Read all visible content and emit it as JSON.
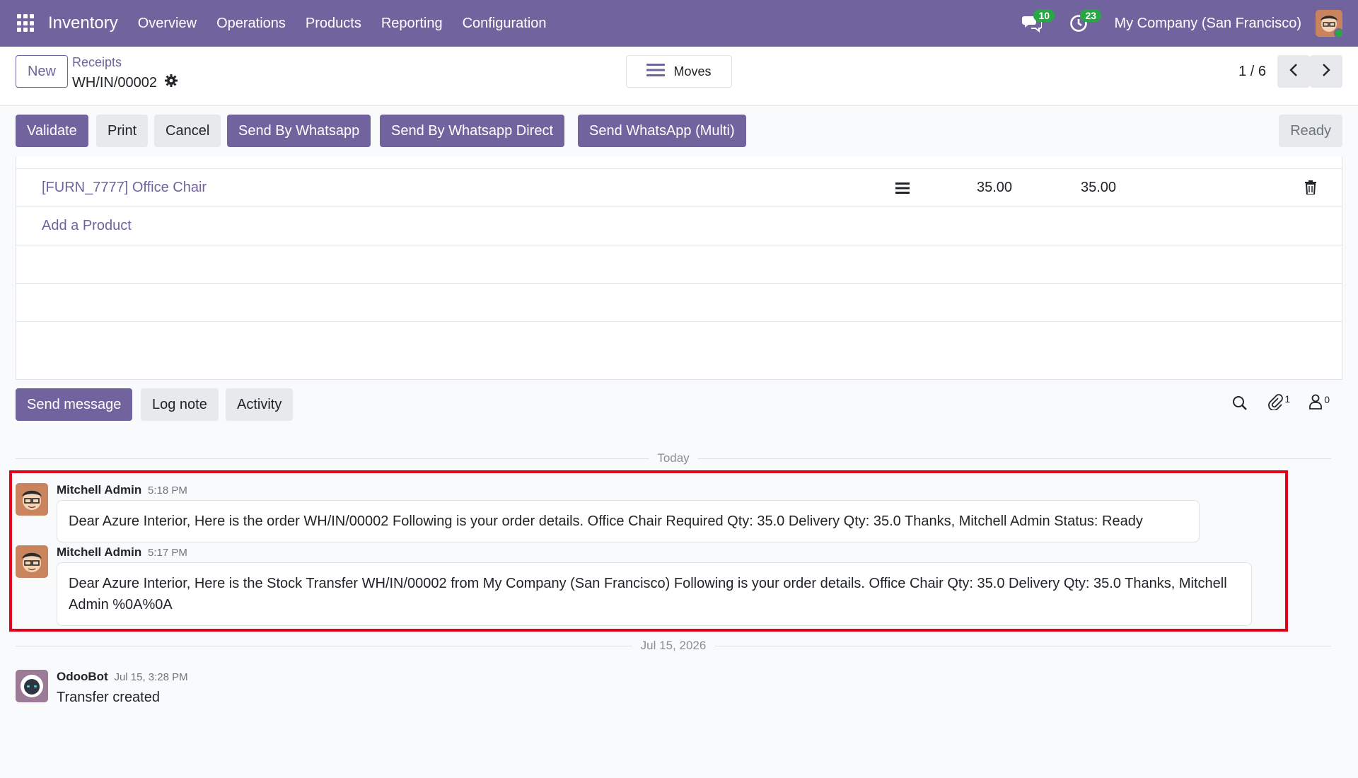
{
  "navbar": {
    "app_name": "Inventory",
    "menu": [
      "Overview",
      "Operations",
      "Products",
      "Reporting",
      "Configuration"
    ],
    "messages_count": "10",
    "activities_count": "23",
    "company": "My Company (San Francisco)"
  },
  "control": {
    "new_label": "New",
    "breadcrumb_parent": "Receipts",
    "breadcrumb_current": "WH/IN/00002",
    "moves_label": "Moves",
    "pager": "1 / 6"
  },
  "statusbar": {
    "buttons": [
      "Validate",
      "Print",
      "Cancel",
      "Send By Whatsapp",
      "Send By Whatsapp Direct",
      "Send WhatsApp (Multi)"
    ],
    "state": "Ready"
  },
  "products": {
    "rows": [
      {
        "name": "[FURN_7777] Office Chair",
        "demand": "35.00",
        "quantity": "35.00"
      }
    ],
    "add_label": "Add a Product"
  },
  "chatter": {
    "send_message": "Send message",
    "log_note": "Log note",
    "activity": "Activity",
    "attachments_count": "1",
    "followers_count": "0"
  },
  "thread": {
    "today_label": "Today",
    "older_label": "Jul 15, 2026",
    "messages": [
      {
        "author": "Mitchell Admin",
        "time": "5:18 PM",
        "body": "Dear Azure Interior, Here is the order WH/IN/00002 Following is your order details. Office Chair Required Qty: 35.0 Delivery Qty: 35.0 Thanks, Mitchell Admin Status: Ready"
      },
      {
        "author": "Mitchell Admin",
        "time": "5:17 PM",
        "body": "Dear Azure Interior, Here is the Stock Transfer WH/IN/00002 from My Company (San Francisco) Following is your order details. Office Chair Qty: 35.0 Delivery Qty: 35.0 Thanks, Mitchell Admin %0A%0A"
      },
      {
        "author": "OdooBot",
        "time": "Jul 15, 3:28 PM",
        "body": "Transfer created"
      }
    ]
  },
  "colors": {
    "brand": "#71639e",
    "highlight": "#e0001a",
    "badge": "#28a745"
  }
}
